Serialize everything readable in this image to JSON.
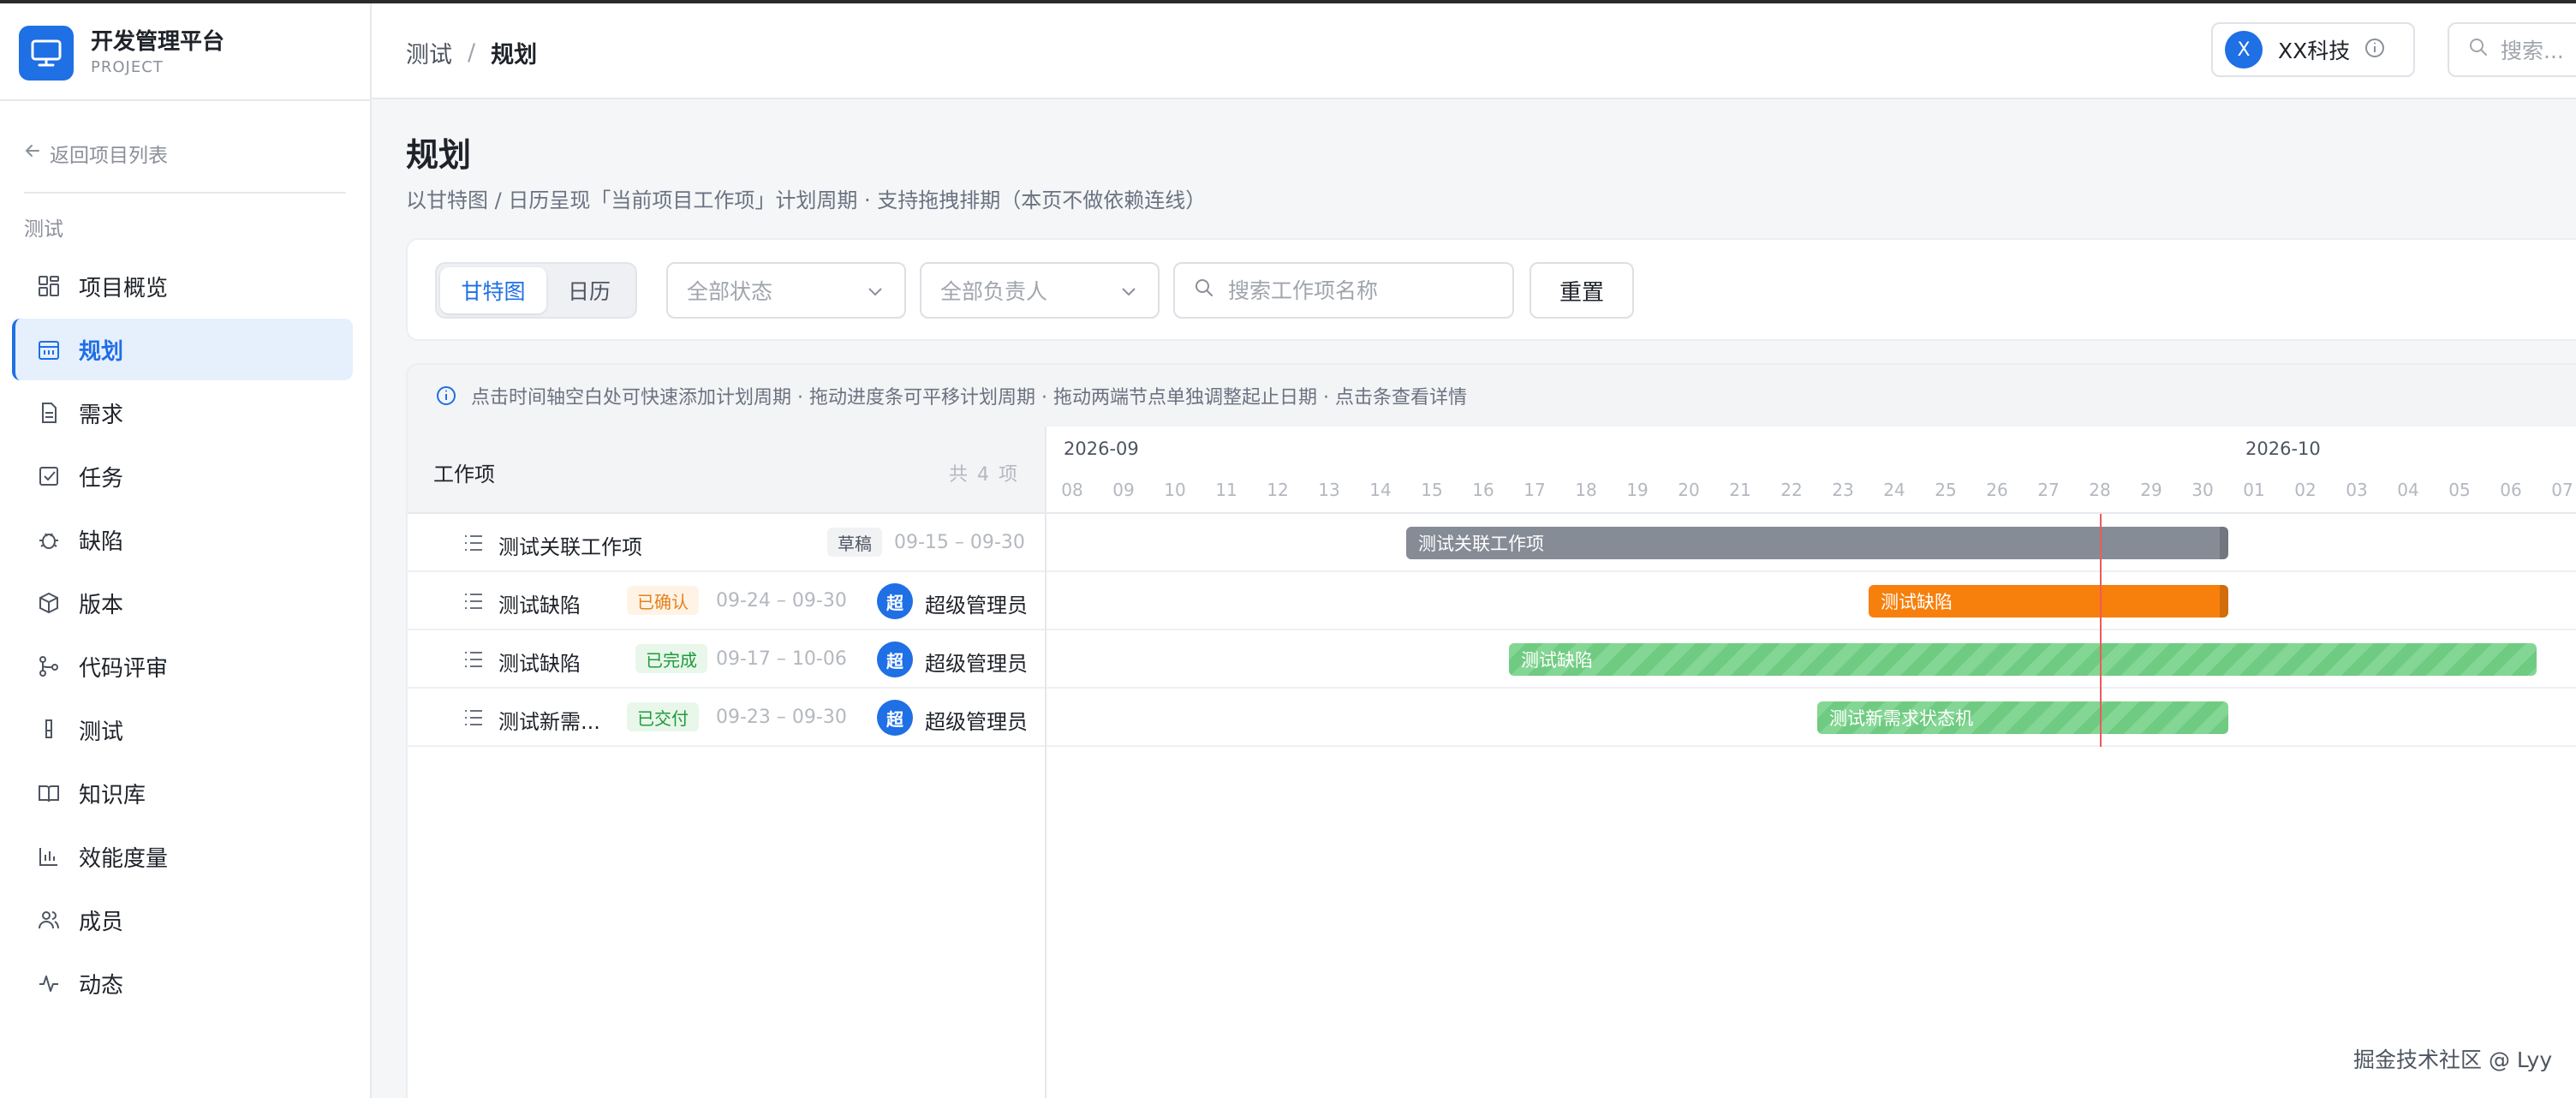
{
  "brand": {
    "title": "开发管理平台",
    "subtitle": "PROJECT"
  },
  "sidebar": {
    "back_label": "返回项目列表",
    "project_name": "测试",
    "items": [
      {
        "label": "项目概览",
        "icon": "grid-icon"
      },
      {
        "label": "规划",
        "icon": "calendar-icon",
        "active": true
      },
      {
        "label": "需求",
        "icon": "document-icon"
      },
      {
        "label": "任务",
        "icon": "checkbox-icon"
      },
      {
        "label": "缺陷",
        "icon": "bug-icon"
      },
      {
        "label": "版本",
        "icon": "package-icon"
      },
      {
        "label": "代码评审",
        "icon": "git-icon"
      },
      {
        "label": "测试",
        "icon": "flask-icon"
      },
      {
        "label": "知识库",
        "icon": "book-icon"
      },
      {
        "label": "效能度量",
        "icon": "bar-chart-icon"
      },
      {
        "label": "成员",
        "icon": "users-icon"
      },
      {
        "label": "动态",
        "icon": "activity-icon"
      }
    ]
  },
  "header": {
    "breadcrumb": [
      "测试",
      "规划"
    ],
    "breadcrumb_sep": "/",
    "org": {
      "avatar": "X",
      "name": "XX科技"
    },
    "search_placeholder": "搜索..."
  },
  "page": {
    "title": "规划",
    "description": "以甘特图 / 日历呈现「当前项目工作项」计划周期 · 支持拖拽排期（本页不做依赖连线）"
  },
  "toolbar": {
    "views": [
      {
        "label": "甘特图",
        "active": true
      },
      {
        "label": "日历",
        "active": false
      }
    ],
    "status_select": "全部状态",
    "assignee_select": "全部负责人",
    "search_placeholder": "搜索工作项名称",
    "reset_label": "重置"
  },
  "gantt": {
    "tip": "点击时间轴空白处可快速添加计划周期 · 拖动进度条可平移计划周期 · 拖动两端节点单独调整起止日期 · 点击条查看详情",
    "list_header": "工作项",
    "count_label": "共 4 项",
    "months": [
      {
        "label": "2026-09",
        "first_day": 0
      },
      {
        "label": "2026-10",
        "first_day": 23
      }
    ],
    "days": [
      "08",
      "09",
      "10",
      "11",
      "12",
      "13",
      "14",
      "15",
      "16",
      "17",
      "18",
      "19",
      "20",
      "21",
      "22",
      "23",
      "24",
      "25",
      "26",
      "27",
      "28",
      "29",
      "30",
      "01",
      "02",
      "03",
      "04",
      "05",
      "06",
      "07"
    ],
    "today_day": 20.5,
    "items": [
      {
        "name": "测试关联工作项",
        "status": "草稿",
        "status_kind": "draft",
        "range": "09-15 – 09-30",
        "assignee": "",
        "avatar": "",
        "bar_label": "测试关联工作项",
        "bar_color": "gray",
        "start": 7,
        "end": 23
      },
      {
        "name": "测试缺陷",
        "status": "已确认",
        "status_kind": "confirmed",
        "range": "09-24 – 09-30",
        "assignee": "超级管理员",
        "avatar": "超",
        "bar_label": "测试缺陷",
        "bar_color": "orange",
        "start": 16,
        "end": 23
      },
      {
        "name": "测试缺陷",
        "status": "已完成",
        "status_kind": "done",
        "range": "09-17 – 10-06",
        "assignee": "超级管理员",
        "avatar": "超",
        "bar_label": "测试缺陷",
        "bar_color": "green",
        "start": 9,
        "end": 29
      },
      {
        "name": "测试新需...",
        "status": "已交付",
        "status_kind": "delivered",
        "range": "09-23 – 09-30",
        "assignee": "超级管理员",
        "avatar": "超",
        "bar_label": "测试新需求状态机",
        "bar_color": "green",
        "start": 15,
        "end": 23
      }
    ]
  },
  "colors": {
    "primary": "#1f6fe5",
    "gray_bar": "#868c96",
    "orange_bar": "#f7800d",
    "green_bar": "#84d694",
    "today": "#ee5a5a"
  },
  "watermark": "掘金技术社区 @ Lyy"
}
